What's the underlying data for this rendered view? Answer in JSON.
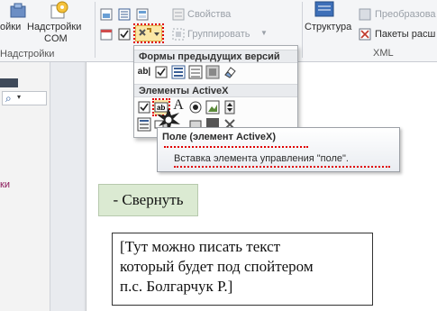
{
  "ribbon": {
    "addins_label": "ойки",
    "com_addins_line1": "Надстройки",
    "com_addins_line2": "COM",
    "addins_group": "Надстройки",
    "properties": "Свойства",
    "group_btn": "Группировать",
    "structure": "Структура",
    "transform": "Преобразова",
    "expansion_packs": "Пакеты расш",
    "xml_group": "XML"
  },
  "dropdown": {
    "legacy_header": "Формы предыдущих версий",
    "activex_header": "Элементы ActiveX"
  },
  "tooltip": {
    "title": "Поле (элемент ActiveX)",
    "description": "Вставка элемента управления \"поле\"."
  },
  "leftpane": {
    "search_icon_char": "⌕",
    "item_text": "ки"
  },
  "document": {
    "collapse_button": "- Свернуть",
    "spoiler_line1": "[Тут можно писать текст",
    "spoiler_line2": "который будет под спойтером",
    "spoiler_line3": "п.с. Болгарчук Р.]"
  },
  "colors": {
    "highlight": "#e00000",
    "button_bg": "#dbead2"
  }
}
